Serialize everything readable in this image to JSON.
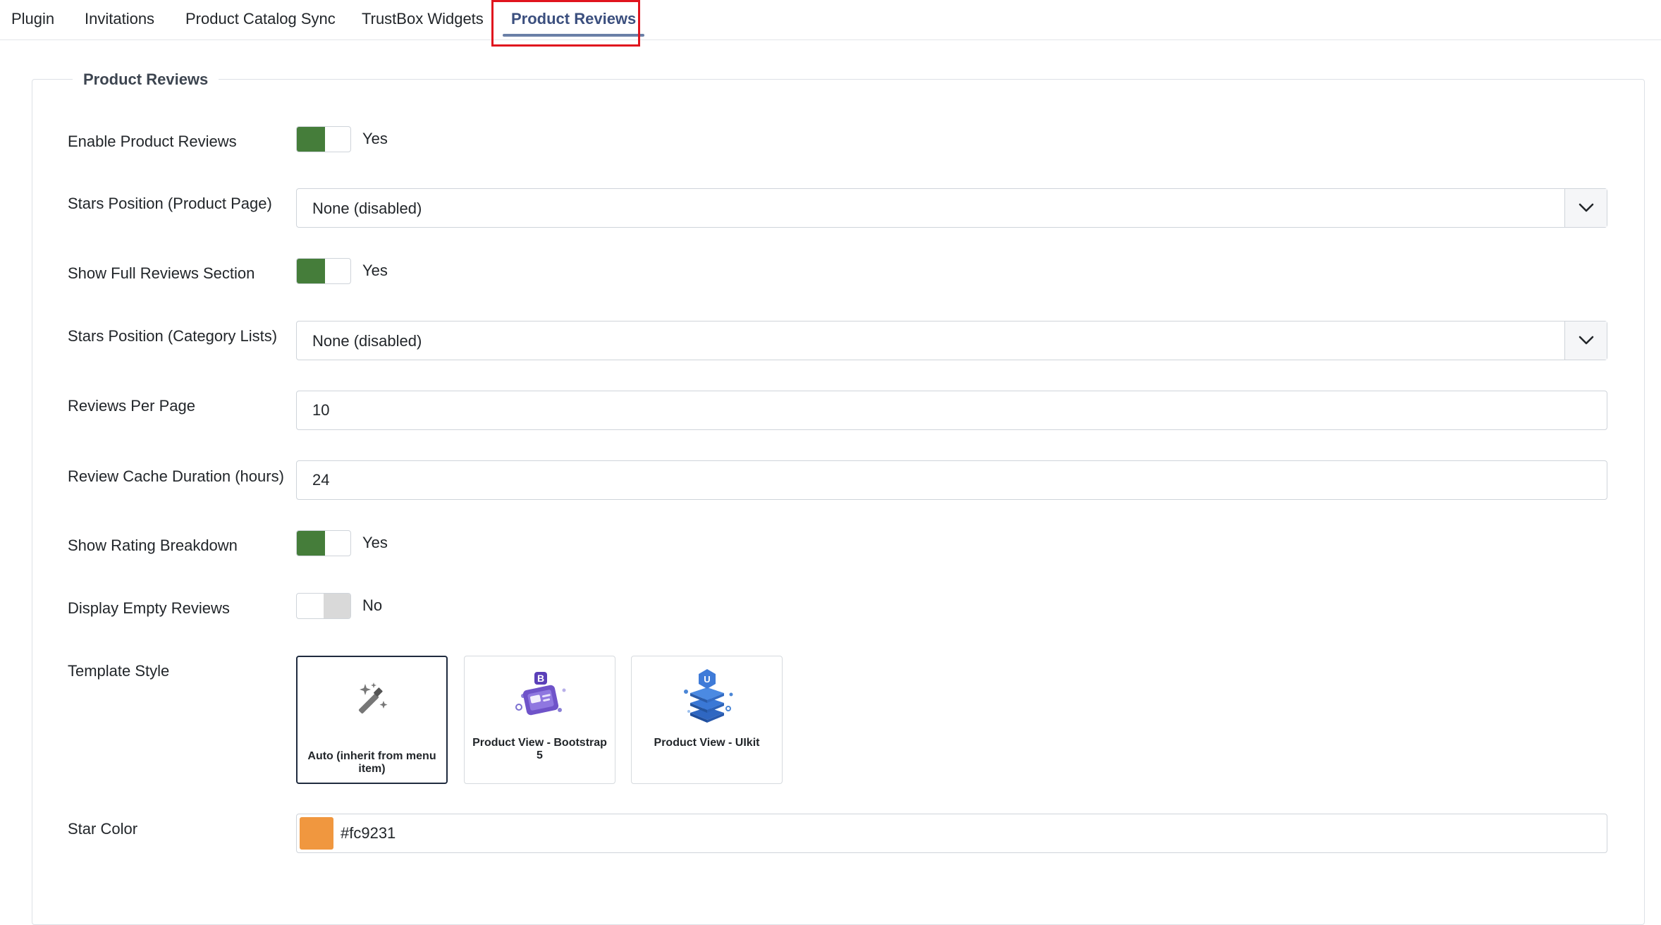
{
  "tabs": [
    {
      "label": "Plugin"
    },
    {
      "label": "Invitations"
    },
    {
      "label": "Product Catalog Sync"
    },
    {
      "label": "TrustBox Widgets"
    },
    {
      "label": "Product Reviews",
      "active": true
    }
  ],
  "fieldset": {
    "legend": "Product Reviews"
  },
  "fields": {
    "enable_product_reviews": {
      "label": "Enable Product Reviews",
      "value": "Yes",
      "on": true
    },
    "stars_position_product": {
      "label": "Stars Position (Product Page)",
      "value": "None (disabled)"
    },
    "show_full_reviews": {
      "label": "Show Full Reviews Section",
      "value": "Yes",
      "on": true
    },
    "stars_position_category": {
      "label": "Stars Position (Category Lists)",
      "value": "None (disabled)"
    },
    "reviews_per_page": {
      "label": "Reviews Per Page",
      "value": "10"
    },
    "review_cache_duration": {
      "label": "Review Cache Duration (hours)",
      "value": "24"
    },
    "show_rating_breakdown": {
      "label": "Show Rating Breakdown",
      "value": "Yes",
      "on": true
    },
    "display_empty_reviews": {
      "label": "Display Empty Reviews",
      "value": "No",
      "on": false
    },
    "template_style": {
      "label": "Template Style",
      "options": [
        {
          "label": "Auto (inherit from menu item)",
          "icon": "magic-wand-icon",
          "selected": true
        },
        {
          "label": "Product View - Bootstrap 5",
          "icon": "bootstrap-icon",
          "selected": false
        },
        {
          "label": "Product View - UIkit",
          "icon": "uikit-icon",
          "selected": false
        }
      ]
    },
    "star_color": {
      "label": "Star Color",
      "value": "#fc9231",
      "swatch": "#f0973f"
    }
  },
  "colors": {
    "toggle_on": "#457d3a",
    "active_tab": "#3b4f7e",
    "highlight": "#e0141e"
  }
}
